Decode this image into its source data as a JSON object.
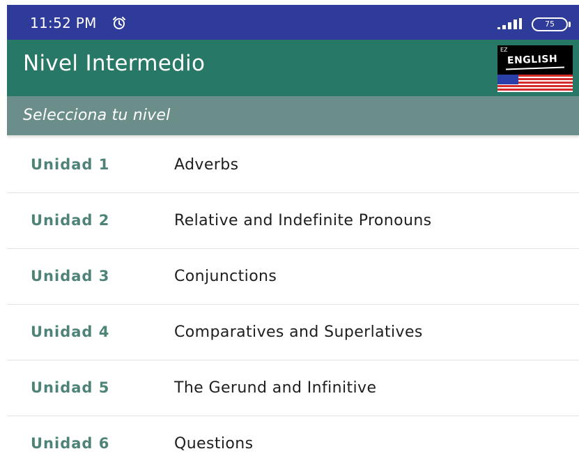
{
  "status_bar": {
    "time": "11:52 PM",
    "battery": "75",
    "color": "#2f3b99"
  },
  "app_bar": {
    "title": "Nivel Intermedio",
    "color": "#277866",
    "logo": {
      "word": "ENGLISH",
      "small_text": "EZ"
    }
  },
  "subtitle": {
    "text": "Selecciona tu nivel",
    "color": "#6c8e8a"
  },
  "units": [
    {
      "label": "Unidad 1",
      "title": "Adverbs"
    },
    {
      "label": "Unidad 2",
      "title": "Relative and Indefinite Pronouns"
    },
    {
      "label": "Unidad 3",
      "title": "Conjunctions"
    },
    {
      "label": "Unidad 4",
      "title": "Comparatives and Superlatives"
    },
    {
      "label": "Unidad 5",
      "title": "The Gerund and Infinitive"
    },
    {
      "label": "Unidad 6",
      "title": "Questions"
    }
  ],
  "colors": {
    "unit_label": "#4e8478",
    "unit_title": "#1e1e1e"
  },
  "icons": {
    "alarm": "alarm-clock-icon",
    "signal": "signal-bars-icon",
    "battery": "battery-icon"
  }
}
